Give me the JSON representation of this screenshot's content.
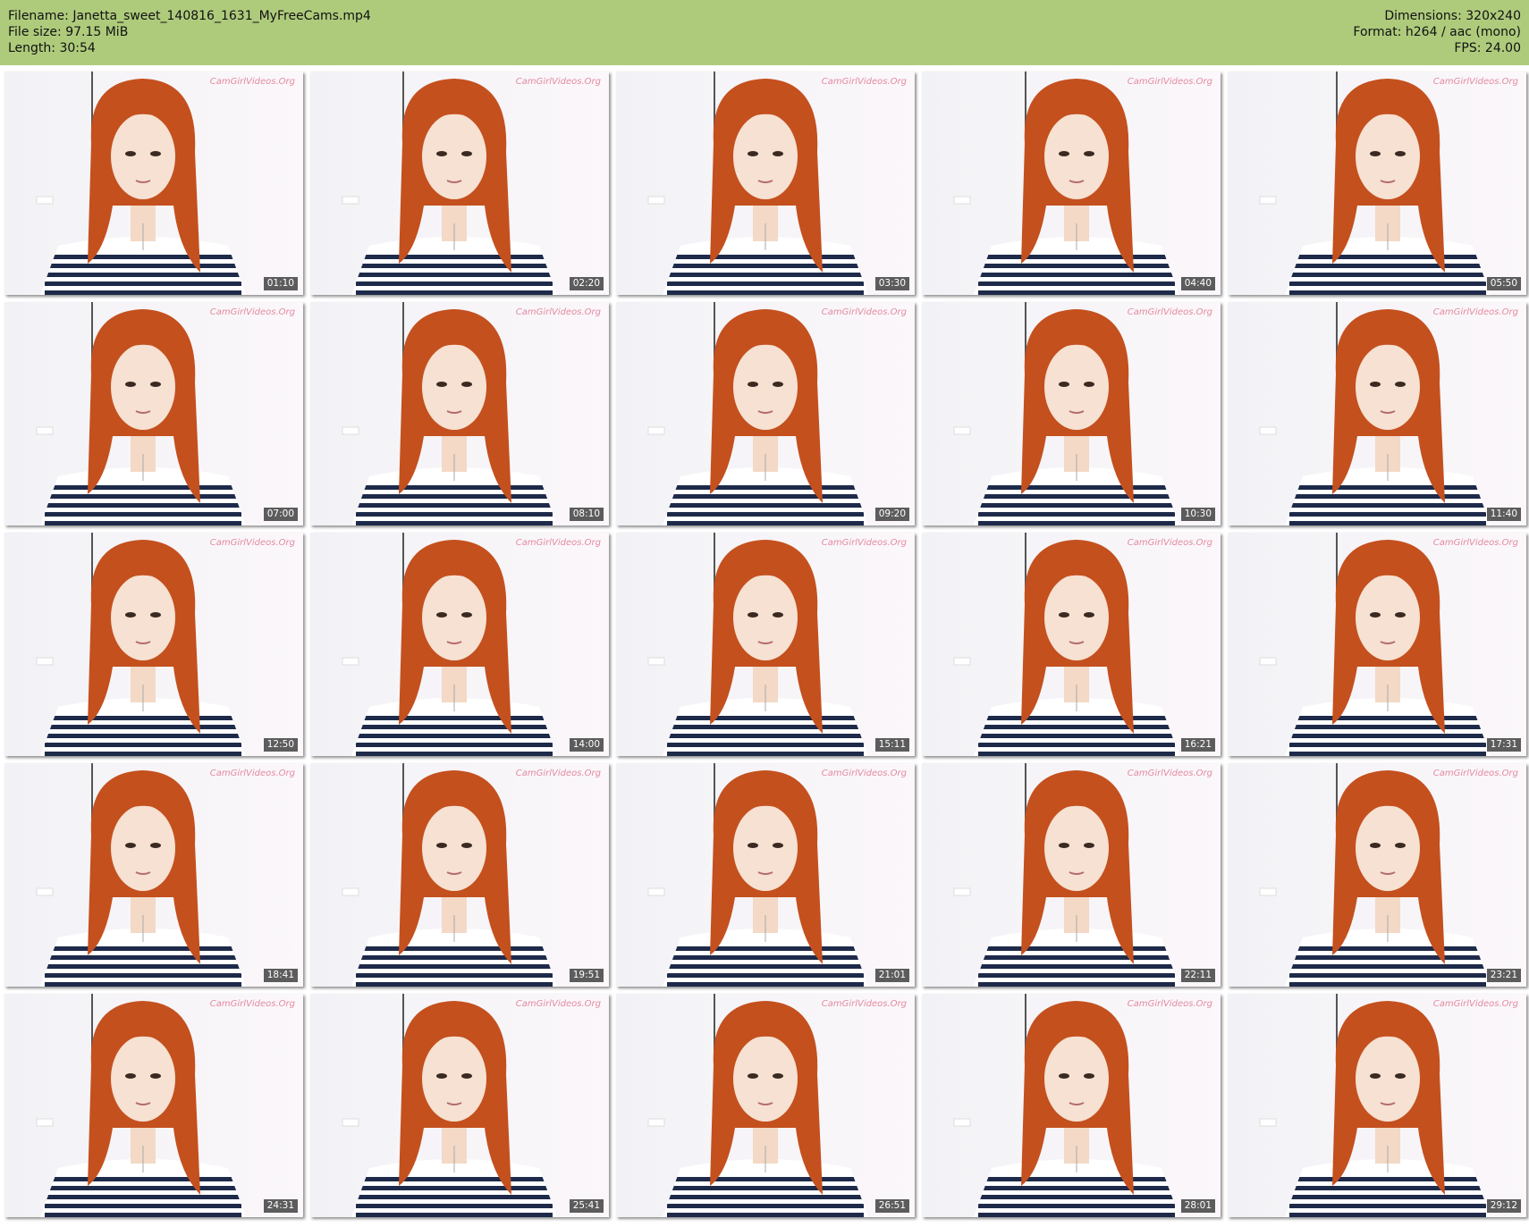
{
  "header": {
    "filename_label": "Filename:",
    "filename": "Janetta_sweet_140816_1631_MyFreeCams.mp4",
    "filesize_label": "File size:",
    "filesize": "97.15 MiB",
    "length_label": "Length:",
    "length": "30:54",
    "dimensions_label": "Dimensions:",
    "dimensions": "320x240",
    "format_label": "Format:",
    "format": "h264 / aac (mono)",
    "fps_label": "FPS:",
    "fps": "24.00"
  },
  "thumbnails": [
    {
      "timestamp": "01:10"
    },
    {
      "timestamp": "02:20"
    },
    {
      "timestamp": "03:30"
    },
    {
      "timestamp": "04:40"
    },
    {
      "timestamp": "05:50"
    },
    {
      "timestamp": "07:00"
    },
    {
      "timestamp": "08:10"
    },
    {
      "timestamp": "09:20"
    },
    {
      "timestamp": "10:30"
    },
    {
      "timestamp": "11:40"
    },
    {
      "timestamp": "12:50"
    },
    {
      "timestamp": "14:00"
    },
    {
      "timestamp": "15:11"
    },
    {
      "timestamp": "16:21"
    },
    {
      "timestamp": "17:31"
    },
    {
      "timestamp": "18:41"
    },
    {
      "timestamp": "19:51"
    },
    {
      "timestamp": "21:01"
    },
    {
      "timestamp": "22:11"
    },
    {
      "timestamp": "23:21"
    },
    {
      "timestamp": "24:31"
    },
    {
      "timestamp": "25:41"
    },
    {
      "timestamp": "26:51"
    },
    {
      "timestamp": "28:01"
    },
    {
      "timestamp": "29:12"
    }
  ],
  "watermark_text": "CamGirlVideos.Org",
  "colors": {
    "header_bg": "#aecb7c",
    "hair": "#c4501e",
    "stripe_dark": "#1e2a4a",
    "accent_pink": "#e8478a"
  }
}
